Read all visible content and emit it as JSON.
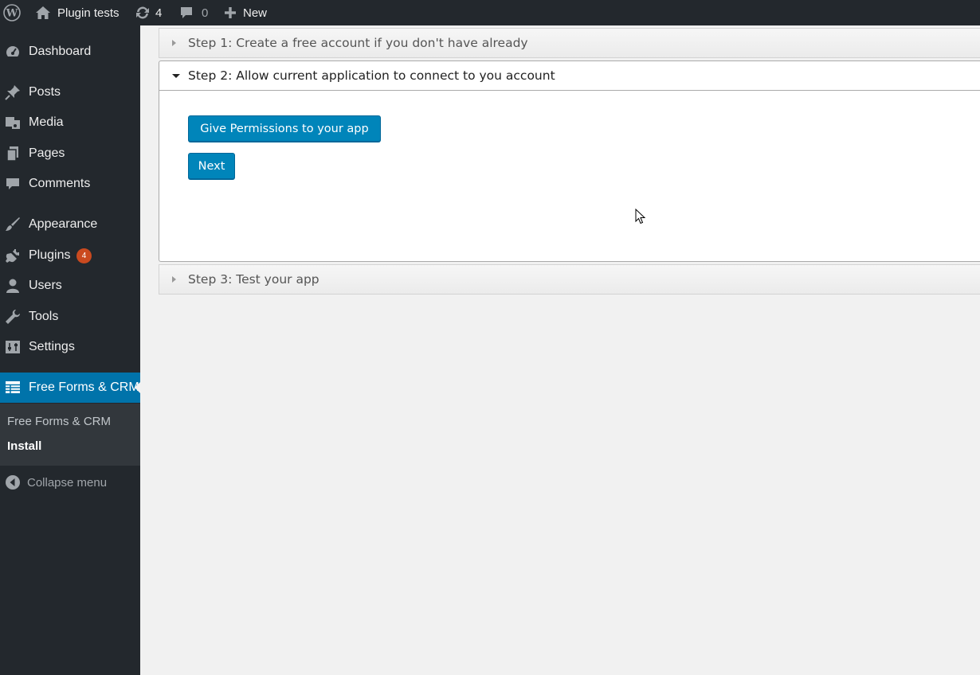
{
  "adminbar": {
    "site_name": "Plugin tests",
    "updates_count": "4",
    "comments_count": "0",
    "new_label": "New"
  },
  "sidebar": {
    "items": [
      {
        "label": "Dashboard",
        "icon": "dashboard-icon"
      },
      {
        "label": "Posts",
        "icon": "pin-icon"
      },
      {
        "label": "Media",
        "icon": "media-icon"
      },
      {
        "label": "Pages",
        "icon": "pages-icon"
      },
      {
        "label": "Comments",
        "icon": "comment-icon"
      },
      {
        "label": "Appearance",
        "icon": "brush-icon"
      },
      {
        "label": "Plugins",
        "icon": "plug-icon",
        "badge": "4"
      },
      {
        "label": "Users",
        "icon": "user-icon"
      },
      {
        "label": "Tools",
        "icon": "wrench-icon"
      },
      {
        "label": "Settings",
        "icon": "settings-icon"
      },
      {
        "label": "Free Forms & CRM",
        "icon": "table-icon",
        "current": true
      }
    ],
    "submenu": [
      {
        "label": "Free Forms & CRM"
      },
      {
        "label": "Install",
        "active": true
      }
    ],
    "collapse_label": "Collapse menu"
  },
  "accordion": {
    "steps": [
      {
        "title": "Step 1: Create a free account if you don't have already",
        "expanded": false
      },
      {
        "title": "Step 2: Allow current application to connect to you account",
        "expanded": true
      },
      {
        "title": "Step 3: Test your app",
        "expanded": false
      }
    ],
    "permissions_button": "Give Permissions to your app",
    "next_button": "Next"
  },
  "colors": {
    "admin_dark": "#23282d",
    "accent": "#0073aa",
    "button": "#0085ba",
    "badge": "#ca4a1f"
  }
}
